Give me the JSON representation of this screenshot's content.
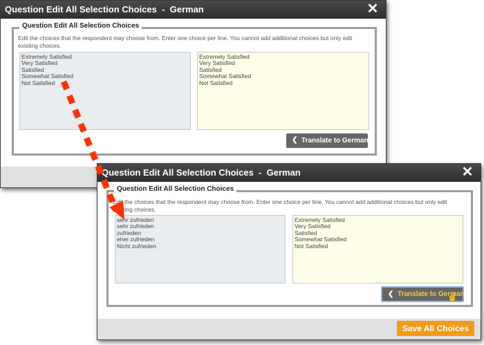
{
  "dialog1": {
    "title": "Question Edit All Selection Choices  -  German",
    "close_icon": "✕",
    "legend": "Question Edit All Selection Choices",
    "instructions": "Edit the choices that the respondent may choose from. Enter one choice per line. You cannot add additional choices but only edit existing choices.",
    "source_choices": [
      "Extremely Satisfied",
      "Very Satisfied",
      "Satisfied",
      "Somewhat Satisfied",
      "Not Satisfied"
    ],
    "target_choices": [
      "Extremely Satisfied",
      "Very Satisfied",
      "Satisfied",
      "Somewhat Satisfied",
      "Not Satisfied"
    ],
    "translate_label": "Translate to German",
    "translate_icon": "chevron-left-icon"
  },
  "dialog2": {
    "title": "Question Edit All Selection Choices  -  German",
    "close_icon": "✕",
    "legend": "Question Edit All Selection Choices",
    "instructions": "Edit the choices that the respondent may choose from. Enter one choice per line. You cannot add additional choices but only edit existing choices.",
    "source_choices": [
      "sehr zufrieden",
      "sehr zufrieden",
      "zufrieden",
      "eher zufrieden",
      "Nicht zufrieden"
    ],
    "target_choices": [
      "Extremely Satisfied",
      "Very Satisfied",
      "Satisfied",
      "Somewhat Satisfied",
      "Not Satisfied"
    ],
    "translate_label": "Translate to German",
    "translate_icon": "chevron-left-icon",
    "save_label": "Save All Choices"
  },
  "colors": {
    "titlebar": "#333333",
    "translate_button": "#666666",
    "translate_text_active": "#f7c548",
    "save_button": "#f49a16",
    "arrow": "#ff3300"
  }
}
